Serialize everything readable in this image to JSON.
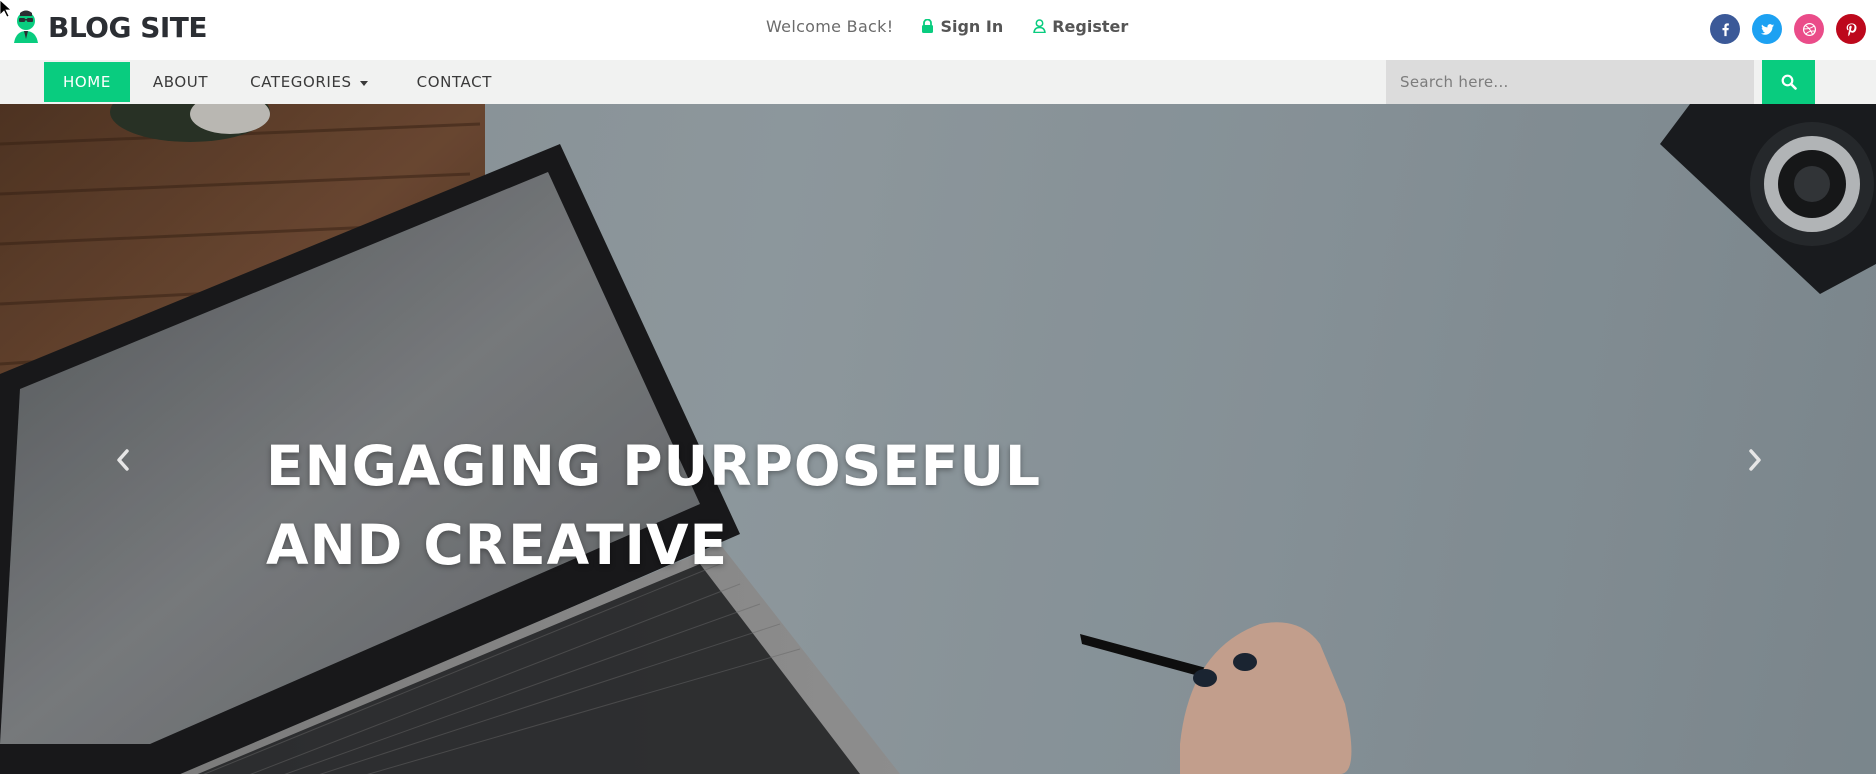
{
  "header": {
    "site_name": "BLOG SITE",
    "welcome": "Welcome Back!",
    "sign_in": "Sign In",
    "register": "Register",
    "social": [
      {
        "icon": "facebook-icon",
        "color": "#3b5998"
      },
      {
        "icon": "twitter-icon",
        "color": "#1da1f2"
      },
      {
        "icon": "dribbble-icon",
        "color": "#ea4c89"
      },
      {
        "icon": "pinterest-icon",
        "color": "#bd081c"
      }
    ]
  },
  "nav": {
    "items": [
      {
        "label": "HOME",
        "active": true
      },
      {
        "label": "ABOUT",
        "active": false
      },
      {
        "label": "CATEGORIES",
        "active": false,
        "dropdown": true
      },
      {
        "label": "CONTACT",
        "active": false
      }
    ],
    "search_placeholder": "Search here..."
  },
  "hero": {
    "title_line1": "ENGAGING PURPOSEFUL",
    "title_line2": "AND CREATIVE"
  },
  "colors": {
    "accent": "#09cc7f",
    "nav_bg": "#f1f2f1",
    "logo_text": "#2b2e33"
  }
}
